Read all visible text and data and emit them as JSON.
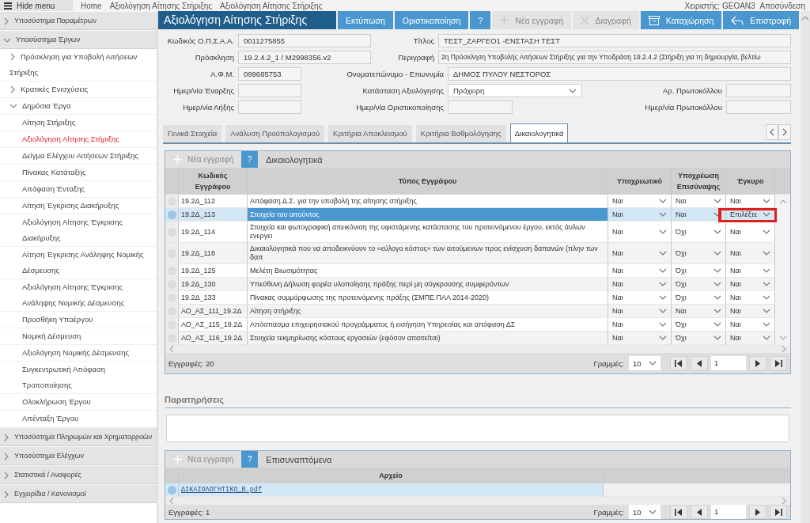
{
  "top_bar": {
    "menu_toggle": "Hide menu",
    "breadcrumbs": [
      "Home",
      "Αξιολόγηση Αίτησης Στήριξης",
      "Αξιολόγηση Αίτησης Στήριξης"
    ],
    "user": "Χειριστής: GEOAN3",
    "logout": "Αποσύνδεση"
  },
  "sidebar": {
    "items": [
      {
        "label": "Υποσύστημα Παραμέτρων",
        "expanded": false
      },
      {
        "label": "Υποσύστημα Έργων",
        "expanded": true,
        "children": [
          {
            "label": "Πρόσκληση για Υποβολή Αιτήσεων Στήριξης",
            "expanded": false
          },
          {
            "label": "Κρατικές Ενισχύσεις",
            "expanded": false
          },
          {
            "label": "Δημόσια Έργα",
            "expanded": true,
            "children": [
              {
                "label": "Αίτηση Στήριξης",
                "selected": false
              },
              {
                "label": "Αξιολόγηση Αίτησης Στήριξης",
                "selected": true
              },
              {
                "label": "Δείγμα Ελέγχου Αιτήσεων Στήριξης",
                "selected": false
              },
              {
                "label": "Πίνακας Κατάταξης",
                "selected": false
              },
              {
                "label": "Απόφαση Ένταξης",
                "selected": false
              },
              {
                "label": "Αίτηση Έγκρισης Διακήρυξης",
                "selected": false
              },
              {
                "label": "Αξιολόγηση Αίτησης Έγκρισης Διακήρυξης",
                "selected": false
              },
              {
                "label": "Αίτηση Έγκρισης Ανάληψης Νομικής Δέσμευσης",
                "selected": false
              },
              {
                "label": "Αξιολόγηση Αίτησης Έγκρισης Ανάληψης Νομικής Δέσμευσης",
                "selected": false
              },
              {
                "label": "Προσθήκη Υποέργου",
                "selected": false
              },
              {
                "label": "Νομική Δέσμευση",
                "selected": false
              },
              {
                "label": "Αξιολόγηση Νομικής Δέσμευσης",
                "selected": false
              },
              {
                "label": "Συγκεντρωτική Απόφαση Τροποποίησης",
                "selected": false
              },
              {
                "label": "Ολοκλήρωση Έργου",
                "selected": false
              },
              {
                "label": "Απένταξη Έργου",
                "selected": false
              }
            ]
          }
        ]
      },
      {
        "label": "Υποσύστημα Πληρωμών και Χρηματορροών",
        "expanded": false
      },
      {
        "label": "Υποσύστημα Ελέγχων",
        "expanded": false
      },
      {
        "label": "Στατιστικά / Αναφορές",
        "expanded": false
      },
      {
        "label": "Εγχειρίδια / Κανονισμοί",
        "expanded": false
      }
    ]
  },
  "header": {
    "title": "Αξιολόγηση Αίτησης Στήριξης",
    "buttons": [
      {
        "label": "Εκτύπωση",
        "kind": "plain",
        "disabled": false
      },
      {
        "label": "Οριστικοποίηση",
        "kind": "plain",
        "disabled": false
      },
      {
        "label": "?",
        "kind": "plain",
        "disabled": false
      },
      {
        "label": "Νέα εγγραφή",
        "kind": "add",
        "disabled": true
      },
      {
        "label": "Διαγραφή",
        "kind": "delete",
        "disabled": true
      },
      {
        "label": "Καταχώρηση",
        "kind": "save",
        "disabled": false
      },
      {
        "label": "Επιστροφή",
        "kind": "back",
        "disabled": false
      }
    ]
  },
  "form": {
    "rows": [
      [
        {
          "label": "Κωδικός Ο.Π.Σ.Α.Α.",
          "value": "0011275855",
          "kind": "text"
        },
        {
          "label": "Τίτλος",
          "value": "ΤΕΣΤ_ΖΑΡΓΕΟ1 -ΕΝΣΤΑΣΗ ΤΕΣΤ",
          "kind": "text"
        }
      ],
      [
        {
          "label": "Πρόσκληση",
          "value": "19.2.4.2_1 / M2998356.v2",
          "kind": "text"
        },
        {
          "label": "Περιγραφή",
          "value": "2η Πρόσκληση Υποβολής Αιτήσεων Στήριξης για την Υποδράση 19.2.4.2 (Στήριξη για τη δημιουργία, βελτίω",
          "kind": "text"
        }
      ],
      [
        {
          "label": "Α.Φ.Μ.",
          "value": "099685753",
          "kind": "text"
        },
        {
          "label": "Ονοματεπώνυμο - Επωνυμία",
          "value": "ΔΗΜΟΣ ΠΥΛΟΥ ΝΕΣΤΟΡΟΣ",
          "kind": "text"
        }
      ],
      [
        {
          "label": "Ημερ/νία Έναρξης",
          "kind": "text"
        },
        {
          "label": "Κατάσταση Αξιολόγησης",
          "value": "Πρόχειρη",
          "kind": "select"
        },
        {
          "label": "Αρ. Πρωτοκόλλου",
          "kind": "text"
        }
      ],
      [
        {
          "label": "Ημερ/νία Λήξης",
          "kind": "text"
        },
        {
          "label": "Ημερ/νία Οριστικοποίησης",
          "kind": "text"
        },
        {
          "label": "Ημερ/νία Πρωτοκόλλου",
          "kind": "text"
        }
      ]
    ]
  },
  "tabs": [
    {
      "label": "Γενικά Στοιχεία",
      "selected": false
    },
    {
      "label": "Ανάλυση Προϋπολογισμού",
      "selected": false
    },
    {
      "label": "Κριτήρια Αποκλεισμού",
      "selected": false
    },
    {
      "label": "Κριτήρια Βαθμολόγησης",
      "selected": false
    },
    {
      "label": "Δικαιολογητικά",
      "selected": true
    }
  ],
  "documents_grid": {
    "new_button": "Νέα εγγραφή",
    "help_button": "?",
    "title": "Δικαιολογητικά",
    "columns": [
      "Κωδικός Εγγράφου",
      "Τύπος Εγγράφου",
      "Υποχρεωτικό",
      "Υποχρέωση Επισύναψης",
      "Έγκυρο"
    ],
    "rows": [
      {
        "selected": false,
        "code": "19.2Δ_112",
        "type": "Απόφαση Δ.Σ.  για την υποβολή της αίτησης στήριξης",
        "mandatory": "Ναι",
        "attachment_required": "Ναι",
        "valid": "Ναι",
        "valid_highlighted": false
      },
      {
        "selected": true,
        "code": "19.2Δ_113",
        "type": "Στοιχεία του αιτούντος",
        "mandatory": "Ναι",
        "attachment_required": "Ναι",
        "valid": "Επιλέξτε",
        "valid_highlighted": true
      },
      {
        "selected": false,
        "code": "19.2Δ_114",
        "type": "Στοιχεία και φωτογραφική απεικόνιση της υφιστάμενης κατάστασης του προτεινόμενου έργου, εκτός άυλων ενεργει",
        "mandatory": "Ναι",
        "attachment_required": "Όχι",
        "valid": "Ναι",
        "valid_highlighted": false
      },
      {
        "selected": false,
        "code": "19.2Δ_118",
        "type": "Δικαιολογητικά που να αποδεικνύουν το «εύλογο κόστος» των αιτούμενων προς ενίσχυση δαπανών (πλην των δαπ",
        "mandatory": "Ναι",
        "attachment_required": "Όχι",
        "valid": "Ναι",
        "valid_highlighted": false
      },
      {
        "selected": false,
        "code": "19.2Δ_125",
        "type": "Μελέτη Βιωσιμότητας",
        "mandatory": "Ναι",
        "attachment_required": "Όχι",
        "valid": "Ναι",
        "valid_highlighted": false
      },
      {
        "selected": false,
        "code": "19.2Δ_130",
        "type": "Υπεύθυνη Δήλωση φορέα υλοποίησης πράξης περί μη σύγκρουσης συμφερόντων",
        "mandatory": "Ναι",
        "attachment_required": "Όχι",
        "valid": "Ναι",
        "valid_highlighted": false
      },
      {
        "selected": false,
        "code": "19.2Δ_133",
        "type": "Πίνακας συμμόρφωσης της προτεινόμενης πράξης (ΣΜΠΕ ΠΑΑ 2014-2020)",
        "mandatory": "Ναι",
        "attachment_required": "Όχι",
        "valid": "Ναι",
        "valid_highlighted": false
      },
      {
        "selected": false,
        "code": "ΑΟ_ΑΣ_111_19.2Δ",
        "type": "Αίτηση στήριξης",
        "mandatory": "Ναι",
        "attachment_required": "Ναι",
        "valid": "Ναι",
        "valid_highlighted": false
      },
      {
        "selected": false,
        "code": "ΑΟ_ΑΣ_115_19.2Δ",
        "type": "Απόσπασμα επιχειρησιακού προγράμματος ή εισήγηση Υπηρεσίας και απόφαση ΔΣ",
        "mandatory": "Ναι",
        "attachment_required": "Όχι",
        "valid": "Ναι",
        "valid_highlighted": false
      },
      {
        "selected": false,
        "code": "ΑΟ_ΑΣ_116_19.2Δ",
        "type": "Στοιχεία τεκμηρίωσης κόστους εργασιών (εφόσον απαιτείται)",
        "mandatory": "Ναι",
        "attachment_required": "Όχι",
        "valid": "Ναι",
        "valid_highlighted": false
      }
    ],
    "record_count": "Εγγραφές: 20",
    "rows_label": "Γραμμές:",
    "page_size": "10",
    "page": "1"
  },
  "remarks": {
    "title": "Παρατηρήσεις"
  },
  "attachments_grid": {
    "new_button": "Νέα εγγραφή",
    "help_button": "?",
    "title": "Επισυναπτόμενα",
    "columns": [
      "Αρχείο"
    ],
    "rows": [
      {
        "selected": true,
        "file": "ΔΙΚΑΙΟΛΟΓΗΤΙΚΟ_Β.pdf"
      }
    ],
    "record_count": "Εγγραφές: 1",
    "rows_label": "Γραμμές:",
    "page_size": "10",
    "page": "1"
  }
}
